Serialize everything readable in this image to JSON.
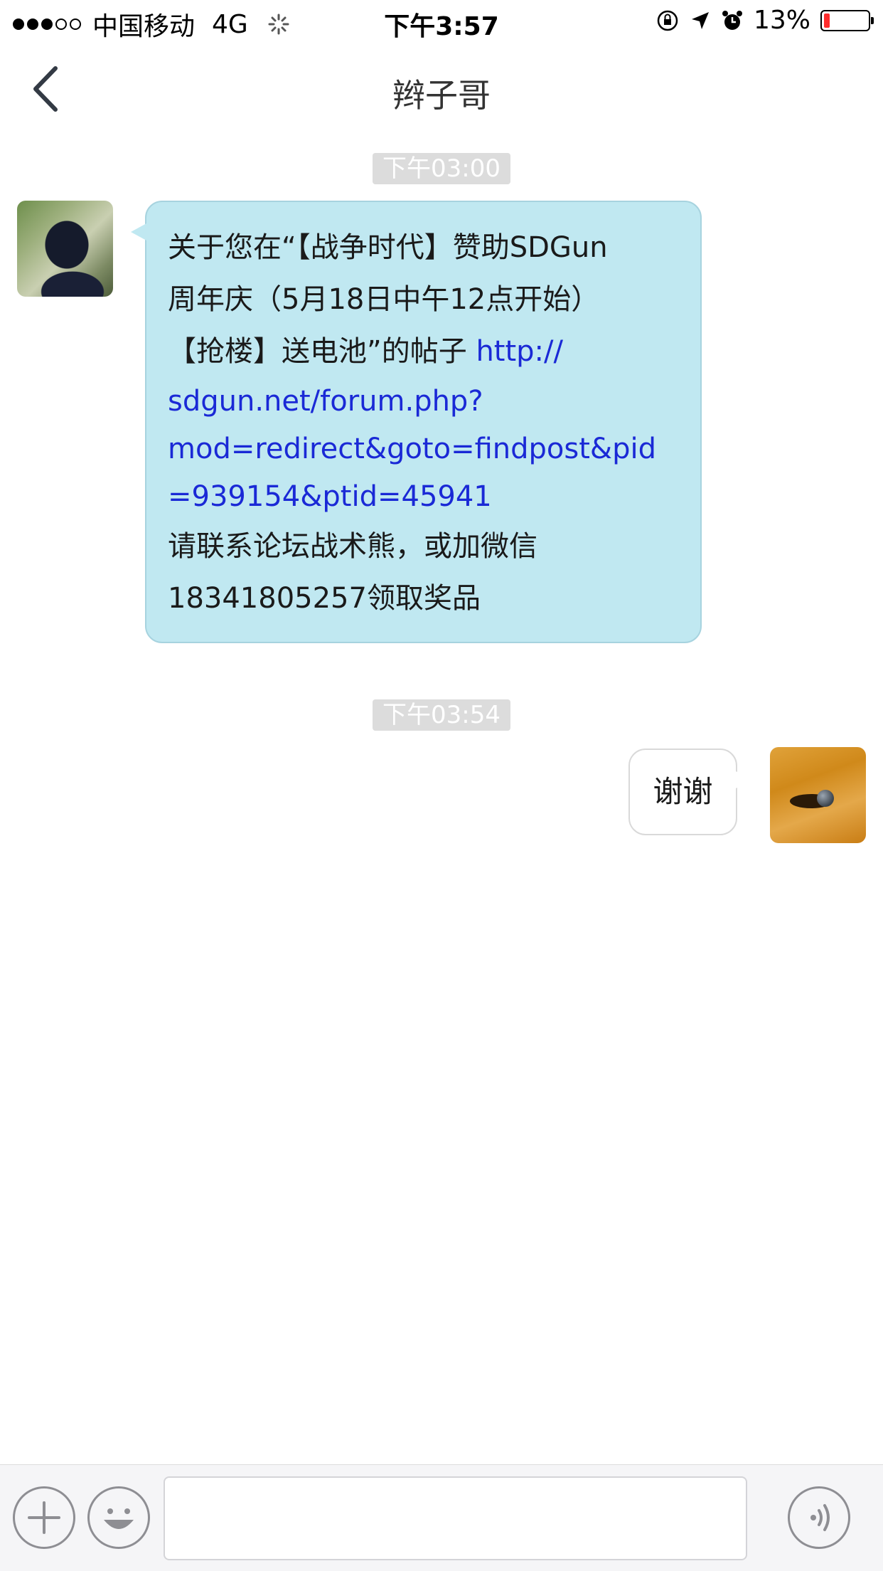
{
  "status_bar": {
    "carrier": "中国移动",
    "network": "4G",
    "time": "下午3:57",
    "battery_percent": "13%",
    "battery_level": 0.13,
    "signal_bars_filled": 3,
    "signal_bars_total": 5
  },
  "nav": {
    "title": "辫子哥"
  },
  "messages": [
    {
      "timestamp": "下午03:00",
      "direction": "incoming",
      "lines": [
        " 关于您在“【战争时代】赞助SDGun",
        "周年庆（5月18日中午12点开始）",
        "【抢楼】送电池”的帖子 "
      ],
      "link_lines": [
        "http://",
        "sdgun.net/forum.php?",
        "mod=redirect&goto=findpost&pid",
        "=939154&ptid=45941"
      ],
      "tail_lines": [
        "请联系论坛战术熊，或加微信",
        "18341805257领取奖品"
      ]
    },
    {
      "timestamp": "下午03:54",
      "direction": "outgoing",
      "text": "谢谢"
    }
  ],
  "input": {
    "value": "",
    "placeholder": ""
  },
  "icons": {
    "back": "chevron-left-icon",
    "plus": "plus-icon",
    "emoji": "smiley-icon",
    "voice": "voice-icon",
    "lock_rotation": "orientation-lock-icon",
    "location": "location-arrow-icon",
    "alarm": "alarm-icon",
    "activity": "activity-spinner-icon"
  },
  "colors": {
    "incoming_bubble": "#c0e8f1",
    "link": "#1a29d6",
    "battery_low": "#ff2d2d"
  }
}
